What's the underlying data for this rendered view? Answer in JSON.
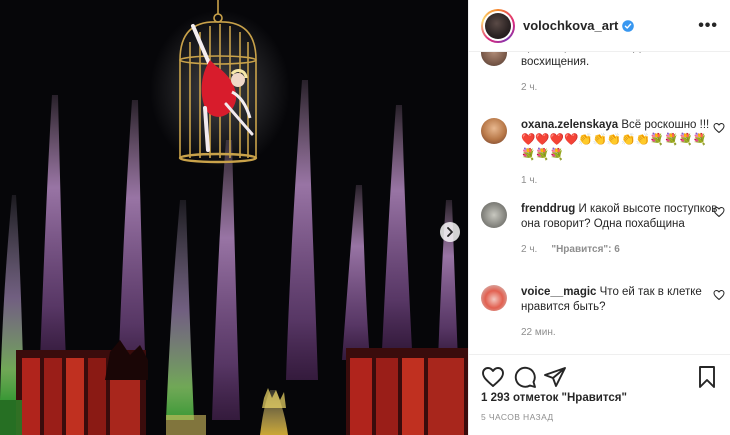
{
  "post": {
    "username": "volochkova_art",
    "verified": true,
    "more_label": "•••"
  },
  "comments": [
    {
      "text": "просто фантастика!!!Достойно восхищения.",
      "time": "2 ч."
    },
    {
      "username": "oxana.zelenskaya",
      "text": "Всё роскошно !!!❤️❤️❤️❤️👏👏👏👏👏💐💐💐💐💐💐💐",
      "time": "1 ч."
    },
    {
      "username": "frenddrug",
      "text": "И какой высоте поступков она говорит? Одна похабщина",
      "time": "2 ч.",
      "likes": "\"Нравится\": 6"
    },
    {
      "username": "voice__magic",
      "text": "Что ей так в клетке нравится быть?",
      "time": "22 мин."
    }
  ],
  "footer": {
    "likes": "1 293 отметок \"Нравится\"",
    "posted": "5 ЧАСОВ НАЗАД"
  },
  "colors": {
    "verified": "#3897f0",
    "meta": "#8e8e8e",
    "text": "#262626"
  },
  "icons": [
    "heart-icon",
    "comment-icon",
    "share-icon",
    "bookmark-icon",
    "chevron-right-icon",
    "more-icon",
    "verified-badge-icon"
  ]
}
